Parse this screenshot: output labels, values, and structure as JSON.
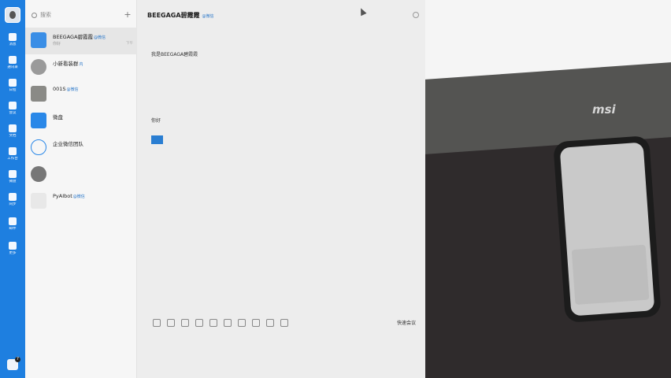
{
  "search": {
    "placeholder": "搜索"
  },
  "nav": [
    {
      "label": "消息"
    },
    {
      "label": "通讯录"
    },
    {
      "label": "日程"
    },
    {
      "label": "会议"
    },
    {
      "label": "文档"
    },
    {
      "label": "工作台"
    },
    {
      "label": "微盘"
    },
    {
      "label": "同步"
    },
    {
      "label": "邮件"
    },
    {
      "label": "更多"
    }
  ],
  "nav_badge": "7",
  "conversations": [
    {
      "name": "BEEGAGA碧霞霞",
      "tag": "@微信",
      "preview": "你好",
      "time": "下午",
      "active": true
    },
    {
      "name": "小新看装群",
      "tag": "内",
      "preview": "",
      "time": ""
    },
    {
      "name": "001S",
      "tag": "@微信",
      "preview": "",
      "time": ""
    },
    {
      "name": "微盘",
      "tag": "",
      "preview": "",
      "time": ""
    },
    {
      "name": "企业微信团队",
      "tag": "",
      "preview": "",
      "time": ""
    },
    {
      "name": "",
      "tag": "",
      "preview": "",
      "time": ""
    },
    {
      "name": "PyAIbot",
      "tag": "@微信",
      "preview": "",
      "time": ""
    }
  ],
  "chat": {
    "title": "BEEGAGA碧霞霞",
    "title_tag": "@微信",
    "messages": [
      {
        "type": "msg",
        "text": "我是BEEGAGA碧霞霞"
      },
      {
        "type": "msg",
        "text": "你好"
      }
    ],
    "meeting_label": "快速会议"
  },
  "photo": {
    "brand": "msi"
  }
}
